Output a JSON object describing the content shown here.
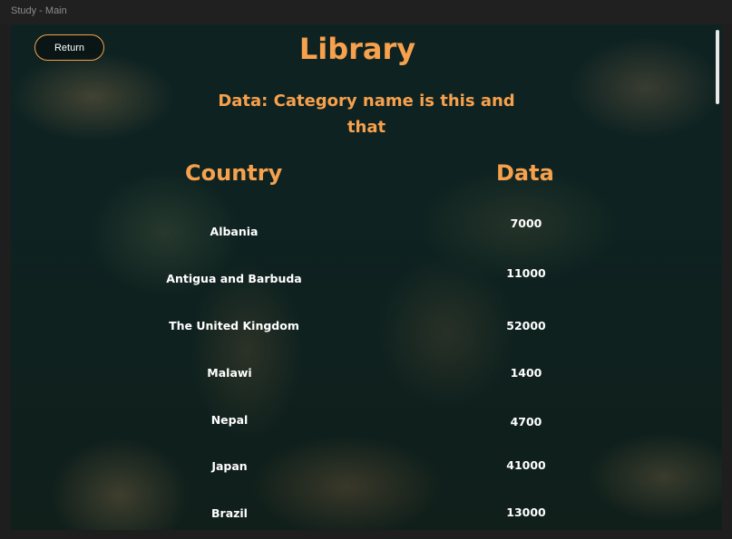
{
  "window": {
    "title": "Study - Main"
  },
  "return_label": "Return",
  "title": "Library",
  "subtitle": "Data: Category name is this and that",
  "table": {
    "headers": [
      "Country",
      "Data"
    ],
    "rows": [
      {
        "country": "Albania",
        "data": "7000"
      },
      {
        "country": "Antigua and Barbuda",
        "data": "11000"
      },
      {
        "country": "The United Kingdom",
        "data": "52000"
      },
      {
        "country": "Malawi",
        "data": "1400"
      },
      {
        "country": "Nepal",
        "data": "4700"
      },
      {
        "country": "Japan",
        "data": "41000"
      },
      {
        "country": "Brazil",
        "data": "13000"
      }
    ]
  },
  "colors": {
    "accent": "#f7a14d",
    "text": "#ffffff"
  }
}
